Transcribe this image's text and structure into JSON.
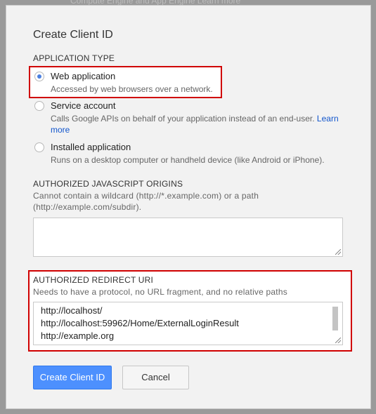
{
  "background": {
    "top_text": "Compute Engine and App Engine Learn more"
  },
  "dialog": {
    "title": "Create Client ID",
    "application_type": {
      "label": "APPLICATION TYPE",
      "options": [
        {
          "label": "Web application",
          "description": "Accessed by web browsers over a network.",
          "selected": true
        },
        {
          "label": "Service account",
          "description": "Calls Google APIs on behalf of your application instead of an end-user.",
          "link": "Learn more",
          "selected": false
        },
        {
          "label": "Installed application",
          "description": "Runs on a desktop computer or handheld device (like Android or iPhone).",
          "selected": false
        }
      ]
    },
    "js_origins": {
      "label": "AUTHORIZED JAVASCRIPT ORIGINS",
      "help_line1": "Cannot contain a wildcard (http://*.example.com) or a path",
      "help_line2": "(http://example.com/subdir).",
      "value": ""
    },
    "redirect_uri": {
      "label": "AUTHORIZED REDIRECT URI",
      "help": "Needs to have a protocol, no URL fragment, and no relative paths",
      "lines": [
        "http://localhost/",
        "http://localhost:59962/Home/ExternalLoginResult",
        "http://example.org"
      ]
    },
    "buttons": {
      "create": "Create Client ID",
      "cancel": "Cancel"
    }
  },
  "colors": {
    "primary_button": "#4d90fe",
    "highlight_border": "#d00000",
    "link": "#1155cc",
    "radio_selected": "#4a7fe0"
  }
}
